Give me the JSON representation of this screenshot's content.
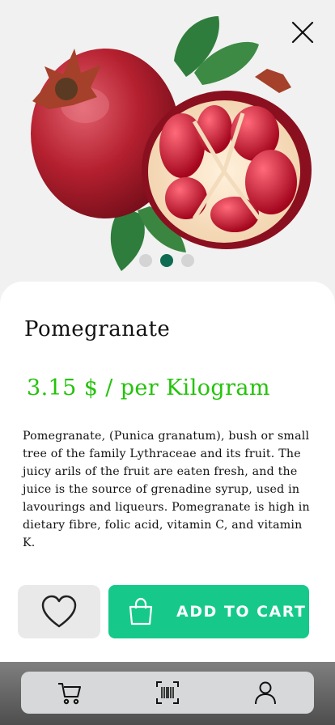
{
  "product": {
    "name": "Pomegranate",
    "price_text": "3.15 $ / per Kilogram",
    "description": "Pomegranate, (Punica granatum), bush or small tree of the family Lythraceae and its fruit. The juicy arils of the fruit are eaten fresh, and the juice is the source of grenadine syrup, used in  lavourings and liqueurs. Pomegranate is high in dietary fibre, folic acid, vitamin C, and vitamin K."
  },
  "gallery": {
    "image_count": 3,
    "active_index": 1
  },
  "actions": {
    "favorite_icon": "heart-icon",
    "add_to_cart_label": "ADD TO CART",
    "add_to_cart_icon": "shopping-bag-icon"
  },
  "nav": {
    "items": [
      {
        "icon": "cart-icon"
      },
      {
        "icon": "barcode-scanner-icon"
      },
      {
        "icon": "user-icon"
      }
    ]
  },
  "colors": {
    "price": "#24c30b",
    "cart_button": "#16c98b",
    "active_dot": "#0f6c52"
  }
}
